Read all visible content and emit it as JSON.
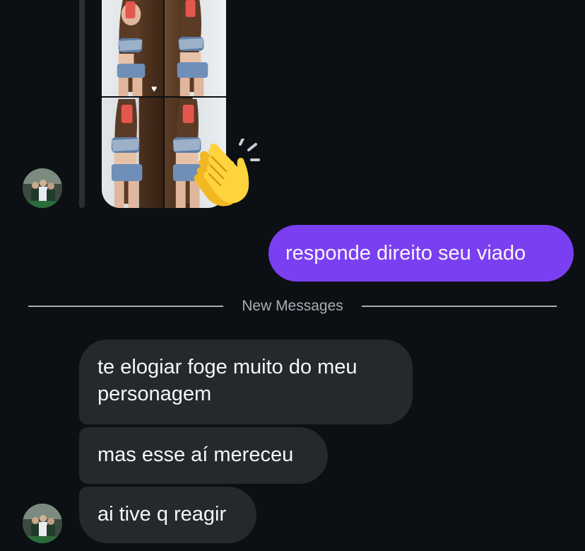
{
  "chat": {
    "sent_message": "responde direito seu viado",
    "divider_label": "New Messages",
    "received_messages": [
      "te elogiar foge muito do meu personagem",
      "mas esse aí mereceu",
      "ai tive q reagir"
    ]
  },
  "media": {
    "reaction_emoji": "clapping-hands-emoji",
    "heart_icon": "heart-icon"
  },
  "colors": {
    "background": "#0c1014",
    "sent_bubble": "#7b3ff2",
    "received_bubble": "#25292e",
    "divider": "#a8adb3",
    "text": "#f5f6f7"
  }
}
